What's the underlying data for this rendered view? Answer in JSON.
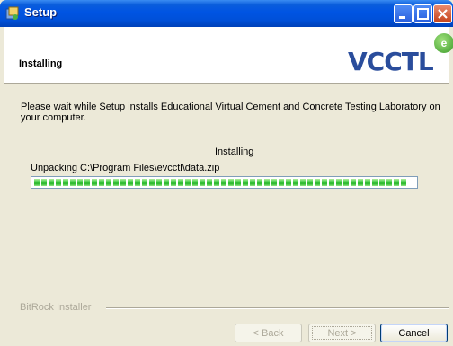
{
  "window": {
    "title": "Setup"
  },
  "header": {
    "title": "Installing",
    "logo_text": "VCCTL",
    "logo_badge": "e"
  },
  "main": {
    "description": "Please wait while Setup installs Educational Virtual Cement and Concrete Testing Laboratory on your computer.",
    "status_label": "Installing",
    "current_action": "Unpacking C:\\Program Files\\evcctl\\data.zip",
    "progress_fraction": 0.98
  },
  "footer": {
    "brand": "BitRock Installer",
    "back_label": "< Back",
    "next_label": "Next >",
    "cancel_label": "Cancel"
  }
}
